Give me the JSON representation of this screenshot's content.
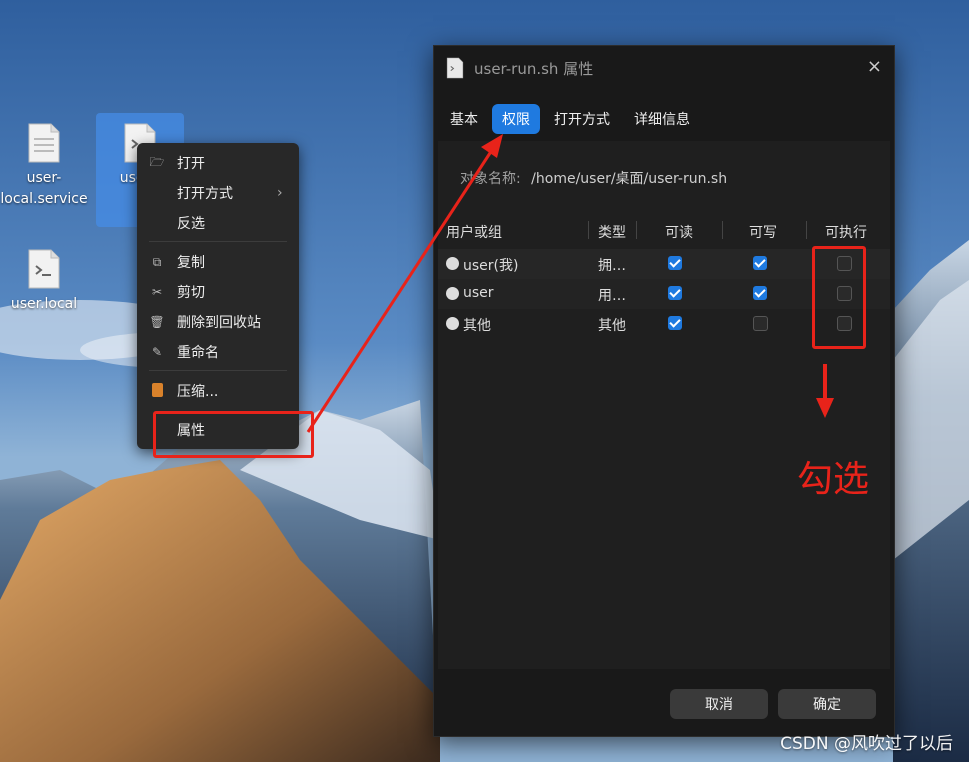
{
  "desktop": {
    "icons": [
      {
        "label_line1": "user-",
        "label_line2": "local.service"
      },
      {
        "label_line1": "user-r",
        "label_line2": ""
      },
      {
        "label_line1": "user.local",
        "label_line2": ""
      }
    ]
  },
  "context_menu": {
    "items": [
      {
        "icon": "folder-icon",
        "label": "打开"
      },
      {
        "icon": "",
        "label": "打开方式",
        "submenu": true
      },
      {
        "icon": "",
        "label": "反选"
      },
      {
        "icon": "copy-icon",
        "label": "复制"
      },
      {
        "icon": "scissors-icon",
        "label": "剪切"
      },
      {
        "icon": "trash-icon",
        "label": "删除到回收站"
      },
      {
        "icon": "rename-icon",
        "label": "重命名"
      },
      {
        "icon": "zip-icon",
        "label": "压缩..."
      },
      {
        "icon": "",
        "label": "属性"
      }
    ],
    "submenu_arrow": "›"
  },
  "dialog": {
    "title": "user-run.sh 属性",
    "close": "×",
    "tabs": [
      "基本",
      "权限",
      "打开方式",
      "详细信息"
    ],
    "active_tab": "权限",
    "name_label": "对象名称:",
    "name_value": "/home/user/桌面/user-run.sh",
    "columns": [
      "用户或组",
      "类型",
      "可读",
      "可写",
      "可执行"
    ],
    "rows": [
      {
        "name": "user(我)",
        "type": "拥…",
        "read": true,
        "write": true,
        "exec": false
      },
      {
        "name": "user",
        "type": "用…",
        "read": true,
        "write": true,
        "exec": false
      },
      {
        "name": "其他",
        "type": "其他",
        "read": true,
        "write": false,
        "exec": false
      }
    ],
    "cancel": "取消",
    "ok": "确定"
  },
  "annotation": {
    "text": "勾选",
    "color": "#e8231a"
  },
  "watermark": "CSDN @风吹过了以后",
  "colors": {
    "accent": "#1f7ae0",
    "dialog_bg": "#191919",
    "menu_bg": "#282828"
  }
}
